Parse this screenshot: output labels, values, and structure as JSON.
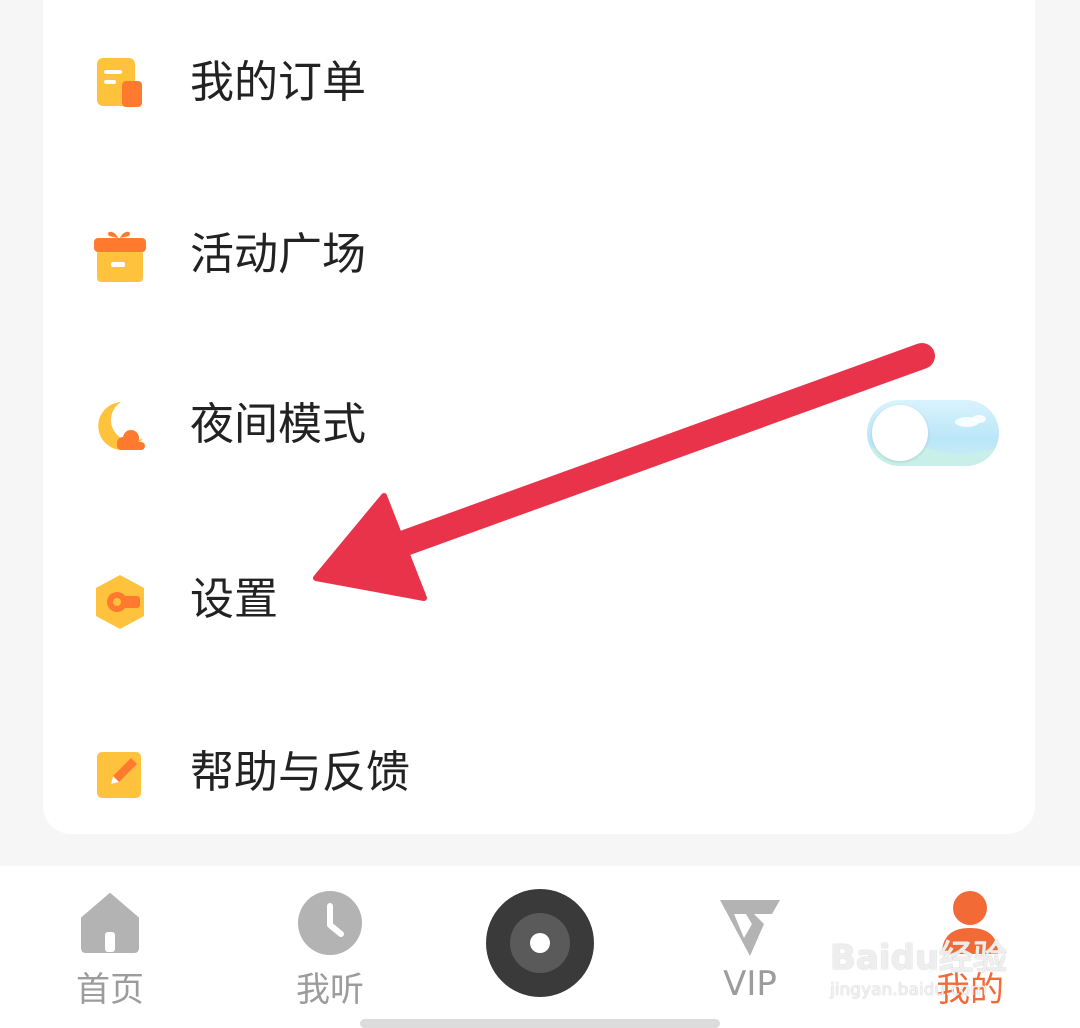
{
  "menu": {
    "items": [
      {
        "label": "我的订单",
        "icon": "order-icon"
      },
      {
        "label": "活动广场",
        "icon": "gift-icon"
      },
      {
        "label": "夜间模式",
        "icon": "moon-cloud-icon",
        "toggle_on": false
      },
      {
        "label": "设置",
        "icon": "settings-icon"
      },
      {
        "label": "帮助与反馈",
        "icon": "edit-icon"
      }
    ]
  },
  "bottom_nav": {
    "tabs": [
      {
        "label": "首页",
        "icon": "home-icon",
        "active": false
      },
      {
        "label": "我听",
        "icon": "clock-icon",
        "active": false
      },
      {
        "label": "",
        "icon": "disc-player-icon",
        "active": false
      },
      {
        "label": "VIP",
        "icon": "vip-icon",
        "active": false
      },
      {
        "label": "我的",
        "icon": "person-icon",
        "active": true
      }
    ]
  },
  "watermark": {
    "line1": "Baidu经验",
    "line2": "jingyan.baidu.com"
  },
  "colors": {
    "accent": "#f26a36",
    "icon_yellow": "#ffc23d",
    "icon_orange": "#ff7a2f",
    "annotation_arrow": "#e8334a",
    "inactive": "#b3b3b3"
  }
}
